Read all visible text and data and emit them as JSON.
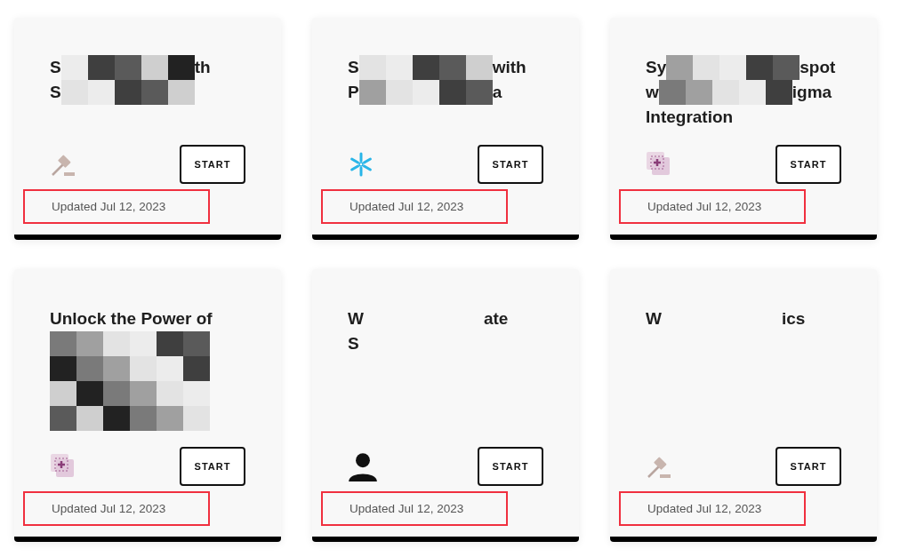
{
  "cards": [
    {
      "title_lines": [
        [
          {
            "kind": "text",
            "text": "S"
          },
          {
            "kind": "mosaic"
          },
          {
            "kind": "text",
            "text": "th"
          }
        ],
        [
          {
            "kind": "text",
            "text": "S"
          },
          {
            "kind": "mosaic"
          }
        ]
      ],
      "button": "START",
      "updated": "Updated Jul 12, 2023",
      "highlighted": true
    },
    {
      "title_lines": [
        [
          {
            "kind": "text",
            "text": "S"
          },
          {
            "kind": "mosaic"
          },
          {
            "kind": "text",
            "text": "with"
          }
        ],
        [
          {
            "kind": "text",
            "text": "P"
          },
          {
            "kind": "mosaic"
          },
          {
            "kind": "text",
            "text": "a"
          }
        ]
      ],
      "button": "START",
      "updated": "Updated Jul 12, 2023",
      "highlighted": true
    },
    {
      "title_lines": [
        [
          {
            "kind": "text",
            "text": "Sy"
          },
          {
            "kind": "mosaic"
          },
          {
            "kind": "text",
            "text": "spot"
          }
        ],
        [
          {
            "kind": "text",
            "text": "w"
          },
          {
            "kind": "mosaic"
          },
          {
            "kind": "text",
            "text": "igma"
          }
        ],
        [
          {
            "kind": "text",
            "text": "Integration"
          }
        ]
      ],
      "button": "START",
      "updated": "Updated Jul 12, 2023",
      "highlighted": true
    },
    {
      "title_lines": [
        [
          {
            "kind": "text",
            "text": "Unlock the Power of"
          }
        ],
        [
          {
            "kind": "mosaic"
          }
        ],
        [
          {
            "kind": "mosaic"
          }
        ],
        [
          {
            "kind": "mosaic"
          }
        ],
        [
          {
            "kind": "mosaic"
          }
        ]
      ],
      "button": "START",
      "updated": "Updated Jul 12, 2023",
      "highlighted": true
    },
    {
      "title_lines": [
        [
          {
            "kind": "text",
            "text": "W"
          },
          {
            "kind": "blank"
          },
          {
            "kind": "text",
            "text": "ate"
          }
        ],
        [
          {
            "kind": "text",
            "text": "S"
          }
        ]
      ],
      "button": "START",
      "updated": "Updated Jul 12, 2023",
      "highlighted": true
    },
    {
      "title_lines": [
        [
          {
            "kind": "text",
            "text": "W"
          },
          {
            "kind": "blank"
          },
          {
            "kind": "text",
            "text": "ics"
          }
        ]
      ],
      "button": "START",
      "updated": "Updated Jul 12, 2023",
      "highlighted": true
    }
  ]
}
